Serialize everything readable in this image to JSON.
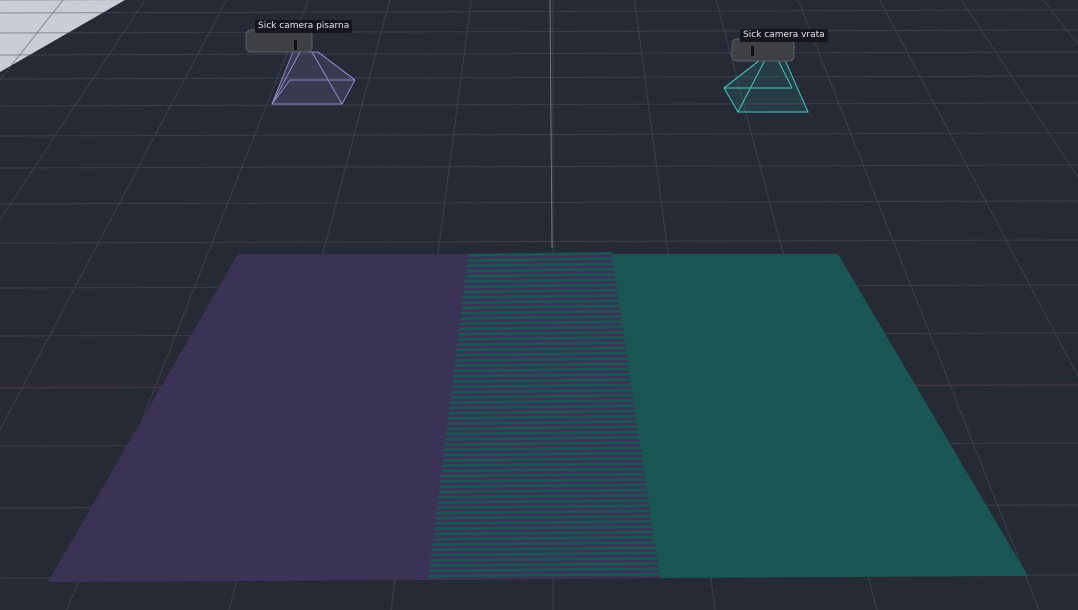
{
  "viewport": {
    "background_color": "#252a35",
    "sky_color": "#c9ced6",
    "grid_color": "#4a5160"
  },
  "cameras": [
    {
      "id": "pisarna",
      "label": "Sick camera pisarna",
      "frustum_color": "#8f86c9"
    },
    {
      "id": "vrata",
      "label": "Sick camera vrata",
      "frustum_color": "#3ec7c0"
    }
  ],
  "floor": {
    "left_zone_color": "#3b3355",
    "right_zone_color": "#1a5654",
    "overlap_pattern": "interleaved-stripes"
  }
}
